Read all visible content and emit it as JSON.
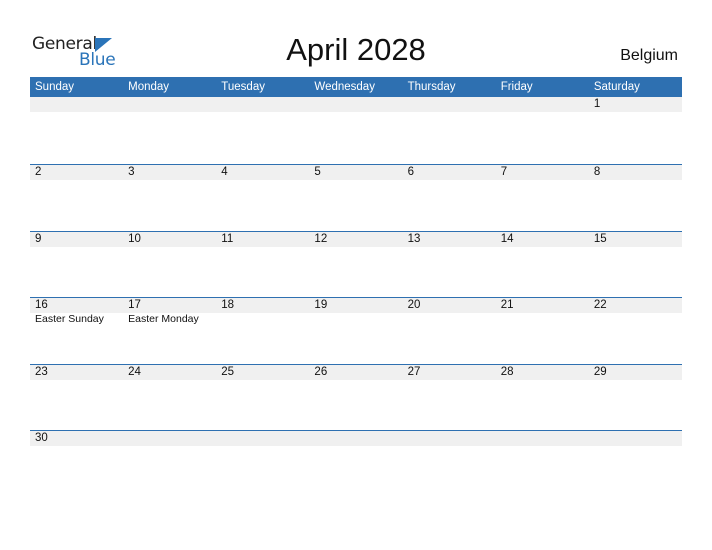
{
  "logo": {
    "text1": "General",
    "text2": "Blue"
  },
  "title": "April 2028",
  "country": "Belgium",
  "weekdays": [
    "Sunday",
    "Monday",
    "Tuesday",
    "Wednesday",
    "Thursday",
    "Friday",
    "Saturday"
  ],
  "weeks": [
    {
      "days": [
        "",
        "",
        "",
        "",
        "",
        "",
        "1"
      ],
      "notes": [
        "",
        "",
        "",
        "",
        "",
        "",
        ""
      ]
    },
    {
      "days": [
        "2",
        "3",
        "4",
        "5",
        "6",
        "7",
        "8"
      ],
      "notes": [
        "",
        "",
        "",
        "",
        "",
        "",
        ""
      ]
    },
    {
      "days": [
        "9",
        "10",
        "11",
        "12",
        "13",
        "14",
        "15"
      ],
      "notes": [
        "",
        "",
        "",
        "",
        "",
        "",
        ""
      ]
    },
    {
      "days": [
        "16",
        "17",
        "18",
        "19",
        "20",
        "21",
        "22"
      ],
      "notes": [
        "Easter Sunday",
        "Easter Monday",
        "",
        "",
        "",
        "",
        ""
      ]
    },
    {
      "days": [
        "23",
        "24",
        "25",
        "26",
        "27",
        "28",
        "29"
      ],
      "notes": [
        "",
        "",
        "",
        "",
        "",
        "",
        ""
      ]
    },
    {
      "days": [
        "30",
        "",
        "",
        "",
        "",
        "",
        ""
      ],
      "notes": [
        "",
        "",
        "",
        "",
        "",
        "",
        ""
      ]
    }
  ],
  "colors": {
    "accent": "#2e70b1",
    "day_bar": "#f0f0f0"
  }
}
